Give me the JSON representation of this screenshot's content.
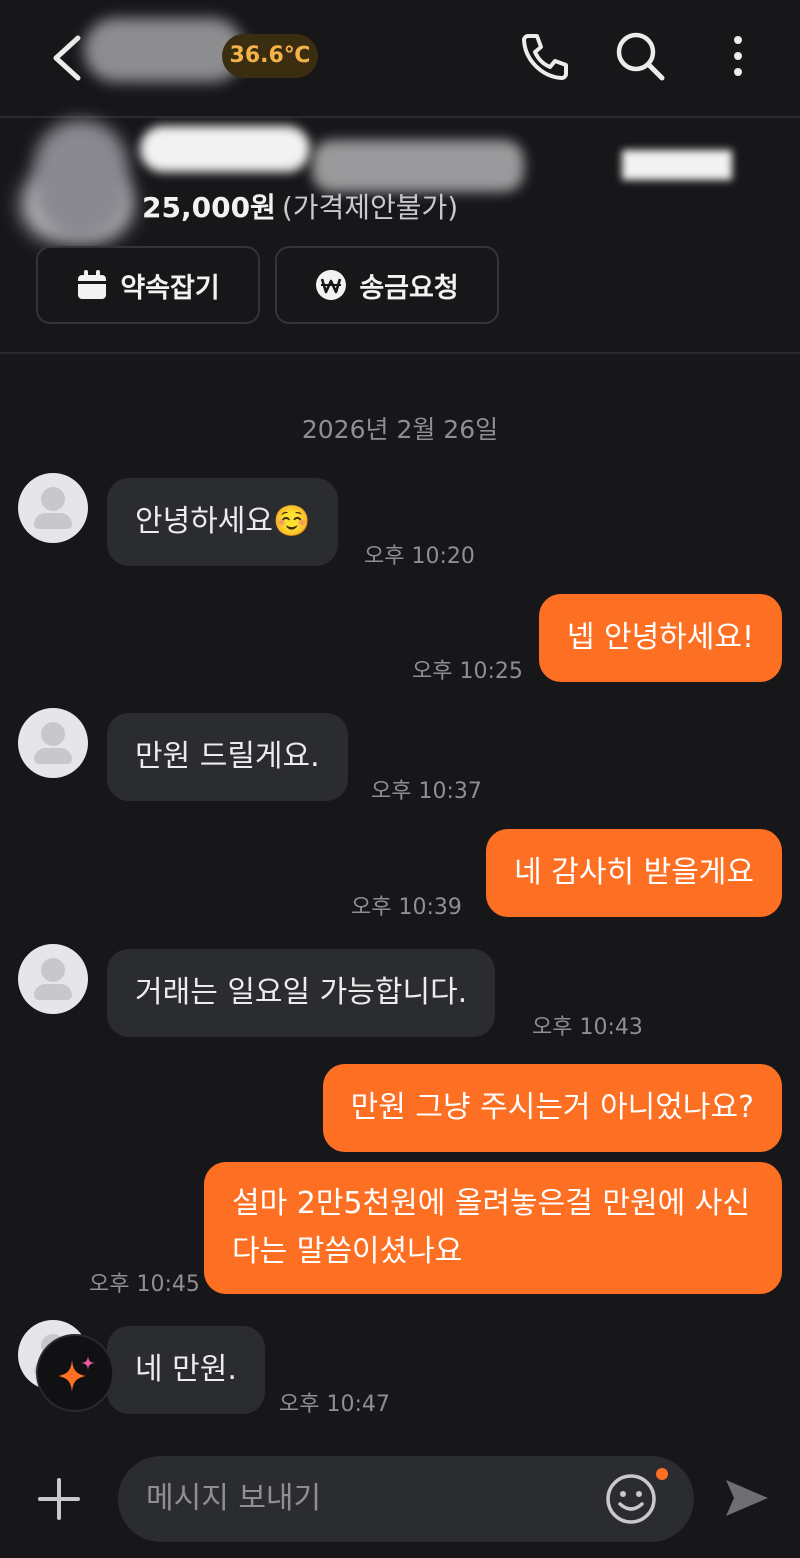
{
  "header": {
    "temperature": "36.6℃",
    "icons": [
      "back-icon",
      "phone-icon",
      "search-icon",
      "more-icon"
    ]
  },
  "product": {
    "price": "25,000원",
    "price_note": "(가격제안불가)",
    "schedule_label": "약속잡기",
    "transfer_label": "송금요청"
  },
  "chat": {
    "date": "2026년 2월 26일",
    "messages": [
      {
        "from": "them",
        "text": "안녕하세요☺️",
        "time": "오후 10:20"
      },
      {
        "from": "me",
        "text": "넵 안녕하세요!",
        "time": "오후 10:25"
      },
      {
        "from": "them",
        "text": "만원 드릴게요.",
        "time": "오후 10:37"
      },
      {
        "from": "me",
        "text": "네 감사히 받을게요",
        "time": "오후 10:39"
      },
      {
        "from": "them",
        "text": "거래는 일요일 가능합니다.",
        "time": "오후 10:43"
      },
      {
        "from": "me",
        "text": "만원 그냥 주시는거 아니었나요?",
        "time": ""
      },
      {
        "from": "me",
        "text": "설마 2만5천원에 올려놓은걸 만원에 사신다는 말씀이셨나요",
        "time": "오후 10:45"
      },
      {
        "from": "them",
        "text": "네 만원.",
        "time": "오후 10:47"
      }
    ]
  },
  "composer": {
    "placeholder": "메시지 보내기"
  },
  "colors": {
    "accent": "#fd6f22",
    "background": "#17171a",
    "incoming_bubble": "#2b2c30",
    "temperature": "#f6b24a"
  }
}
